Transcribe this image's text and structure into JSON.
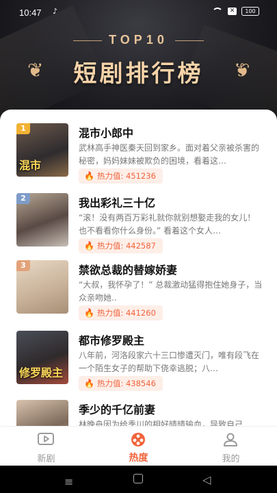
{
  "status_bar": {
    "time": "10:47",
    "battery": "100"
  },
  "header": {
    "top_label": "TOP10",
    "title": "短剧排行榜"
  },
  "items": [
    {
      "rank": "1",
      "title": "混市小郎中",
      "desc": "武林高手神医秦天回到家乡。面对着父亲被杀害的秘密，妈妈妹妹被欺负的困境，看着这…",
      "heat_label": "热力值: 451236",
      "cover_caption": "混市",
      "rank_color": "#f2b233"
    },
    {
      "rank": "2",
      "title": "我出彩礼三十亿",
      "desc": "“滚！没有两百万彩礼就你就别想娶走我的女儿！也不看看你什么身份。” 看着这个女人…",
      "heat_label": "热力值: 442587",
      "cover_caption": "",
      "rank_color": "#7f9cc9"
    },
    {
      "rank": "3",
      "title": "禁欲总裁的替嫁娇妻",
      "desc": "“大叔，我怀孕了！” 总裁激动猛得抱住她身子，当众亲吻她..",
      "heat_label": "热力值: 441260",
      "cover_caption": "",
      "rank_color": "#e2a27a"
    },
    {
      "rank": "",
      "title": "都市修罗殿主",
      "desc": "八年前，河洛段家六十三口惨遭灭门，唯有段飞在一个陌生女子的帮助下侥幸逃脱；八…",
      "heat_label": "热力值: 438546",
      "cover_caption": "修罗殿主",
      "rank_color": ""
    },
    {
      "rank": "",
      "title": "季少的千亿前妻",
      "desc": "林晚舟因为给季川的相好晴晴输血，导致自己…",
      "heat_label": "",
      "cover_caption": "",
      "rank_color": ""
    }
  ],
  "tabbar": {
    "tabs": [
      {
        "label": "新剧"
      },
      {
        "label": "热度"
      },
      {
        "label": "我的"
      }
    ]
  },
  "colors": {
    "accent": "#f0643c",
    "gold": "#e8c59a"
  }
}
